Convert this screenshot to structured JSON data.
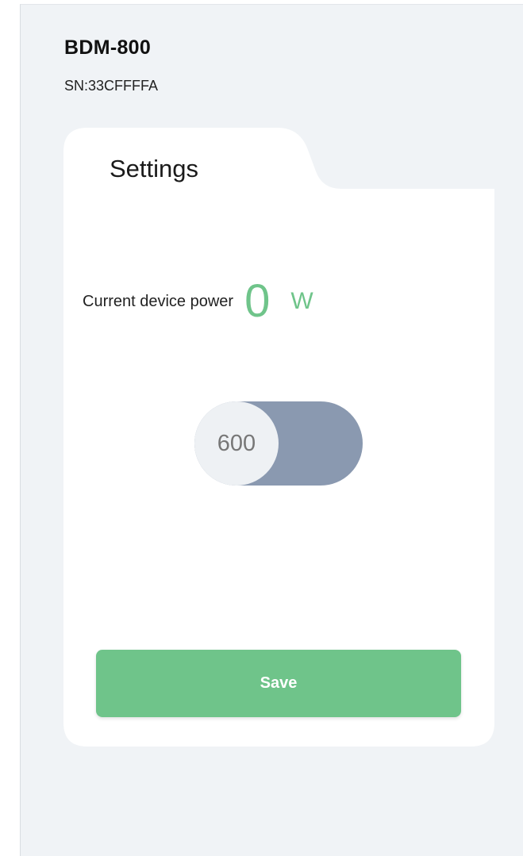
{
  "device": {
    "name": "BDM-800",
    "serial": "SN:33CFFFFA"
  },
  "settings": {
    "tab_label": "Settings",
    "power_label": "Current device power",
    "power_value": "0",
    "power_unit": "W",
    "toggle_value": "600",
    "save_label": "Save"
  },
  "colors": {
    "accent_green": "#6fc48a",
    "toggle_track": "#8a99b0",
    "background": "#f0f3f6"
  }
}
